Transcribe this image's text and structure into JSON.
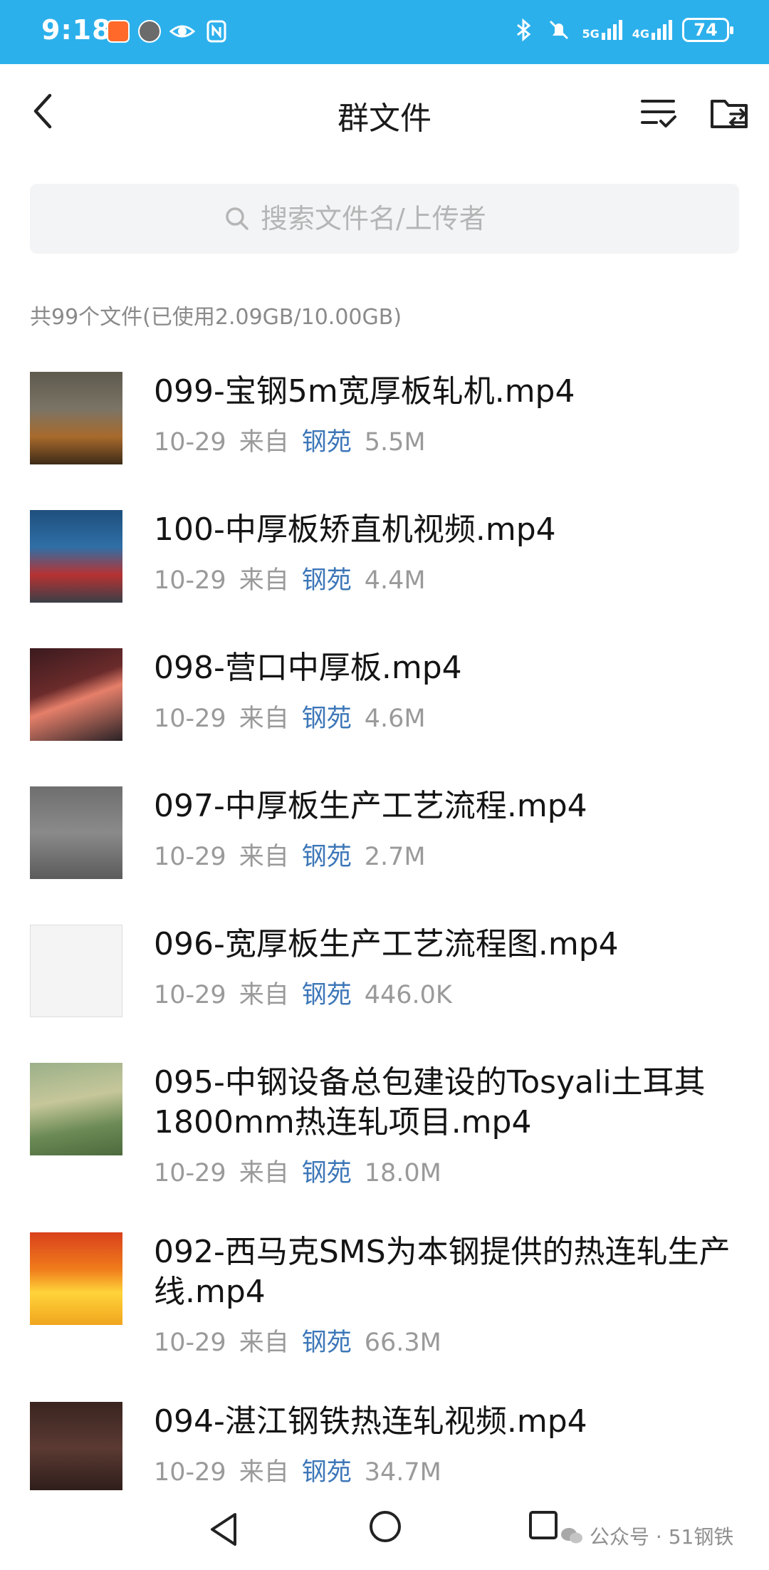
{
  "status_bar": {
    "time": "9:18",
    "battery": "74",
    "signal1": "5G",
    "signal2": "4G"
  },
  "header": {
    "title": "群文件"
  },
  "search": {
    "placeholder": "搜索文件名/上传者"
  },
  "summary": "共99个文件(已使用2.09GB/10.00GB)",
  "files": [
    {
      "name": "099-宝钢5m宽厚板轧机.mp4",
      "date": "10-29",
      "from_label": "来自",
      "uploader": "钢苑",
      "size": "5.5M",
      "thumb": "t1"
    },
    {
      "name": "100-中厚板矫直机视频.mp4",
      "date": "10-29",
      "from_label": "来自",
      "uploader": "钢苑",
      "size": "4.4M",
      "thumb": "t2"
    },
    {
      "name": "098-营口中厚板.mp4",
      "date": "10-29",
      "from_label": "来自",
      "uploader": "钢苑",
      "size": "4.6M",
      "thumb": "t3"
    },
    {
      "name": "097-中厚板生产工艺流程.mp4",
      "date": "10-29",
      "from_label": "来自",
      "uploader": "钢苑",
      "size": "2.7M",
      "thumb": "t4"
    },
    {
      "name": "096-宽厚板生产工艺流程图.mp4",
      "date": "10-29",
      "from_label": "来自",
      "uploader": "钢苑",
      "size": "446.0K",
      "thumb": "t5"
    },
    {
      "name": "095-中钢设备总包建设的Tosyali土耳其1800mm热连轧项目.mp4",
      "date": "10-29",
      "from_label": "来自",
      "uploader": "钢苑",
      "size": "18.0M",
      "thumb": "t6"
    },
    {
      "name": "092-西马克SMS为本钢提供的热连轧生产线.mp4",
      "date": "10-29",
      "from_label": "来自",
      "uploader": "钢苑",
      "size": "66.3M",
      "thumb": "t7"
    },
    {
      "name": "094-湛江钢铁热连轧视频.mp4",
      "date": "10-29",
      "from_label": "来自",
      "uploader": "钢苑",
      "size": "34.7M",
      "thumb": "t8"
    }
  ],
  "watermark": "公众号 · 51钢铁",
  "colors": {
    "status_bar": "#2cb0ec",
    "uploader_link": "#3d77b8"
  }
}
